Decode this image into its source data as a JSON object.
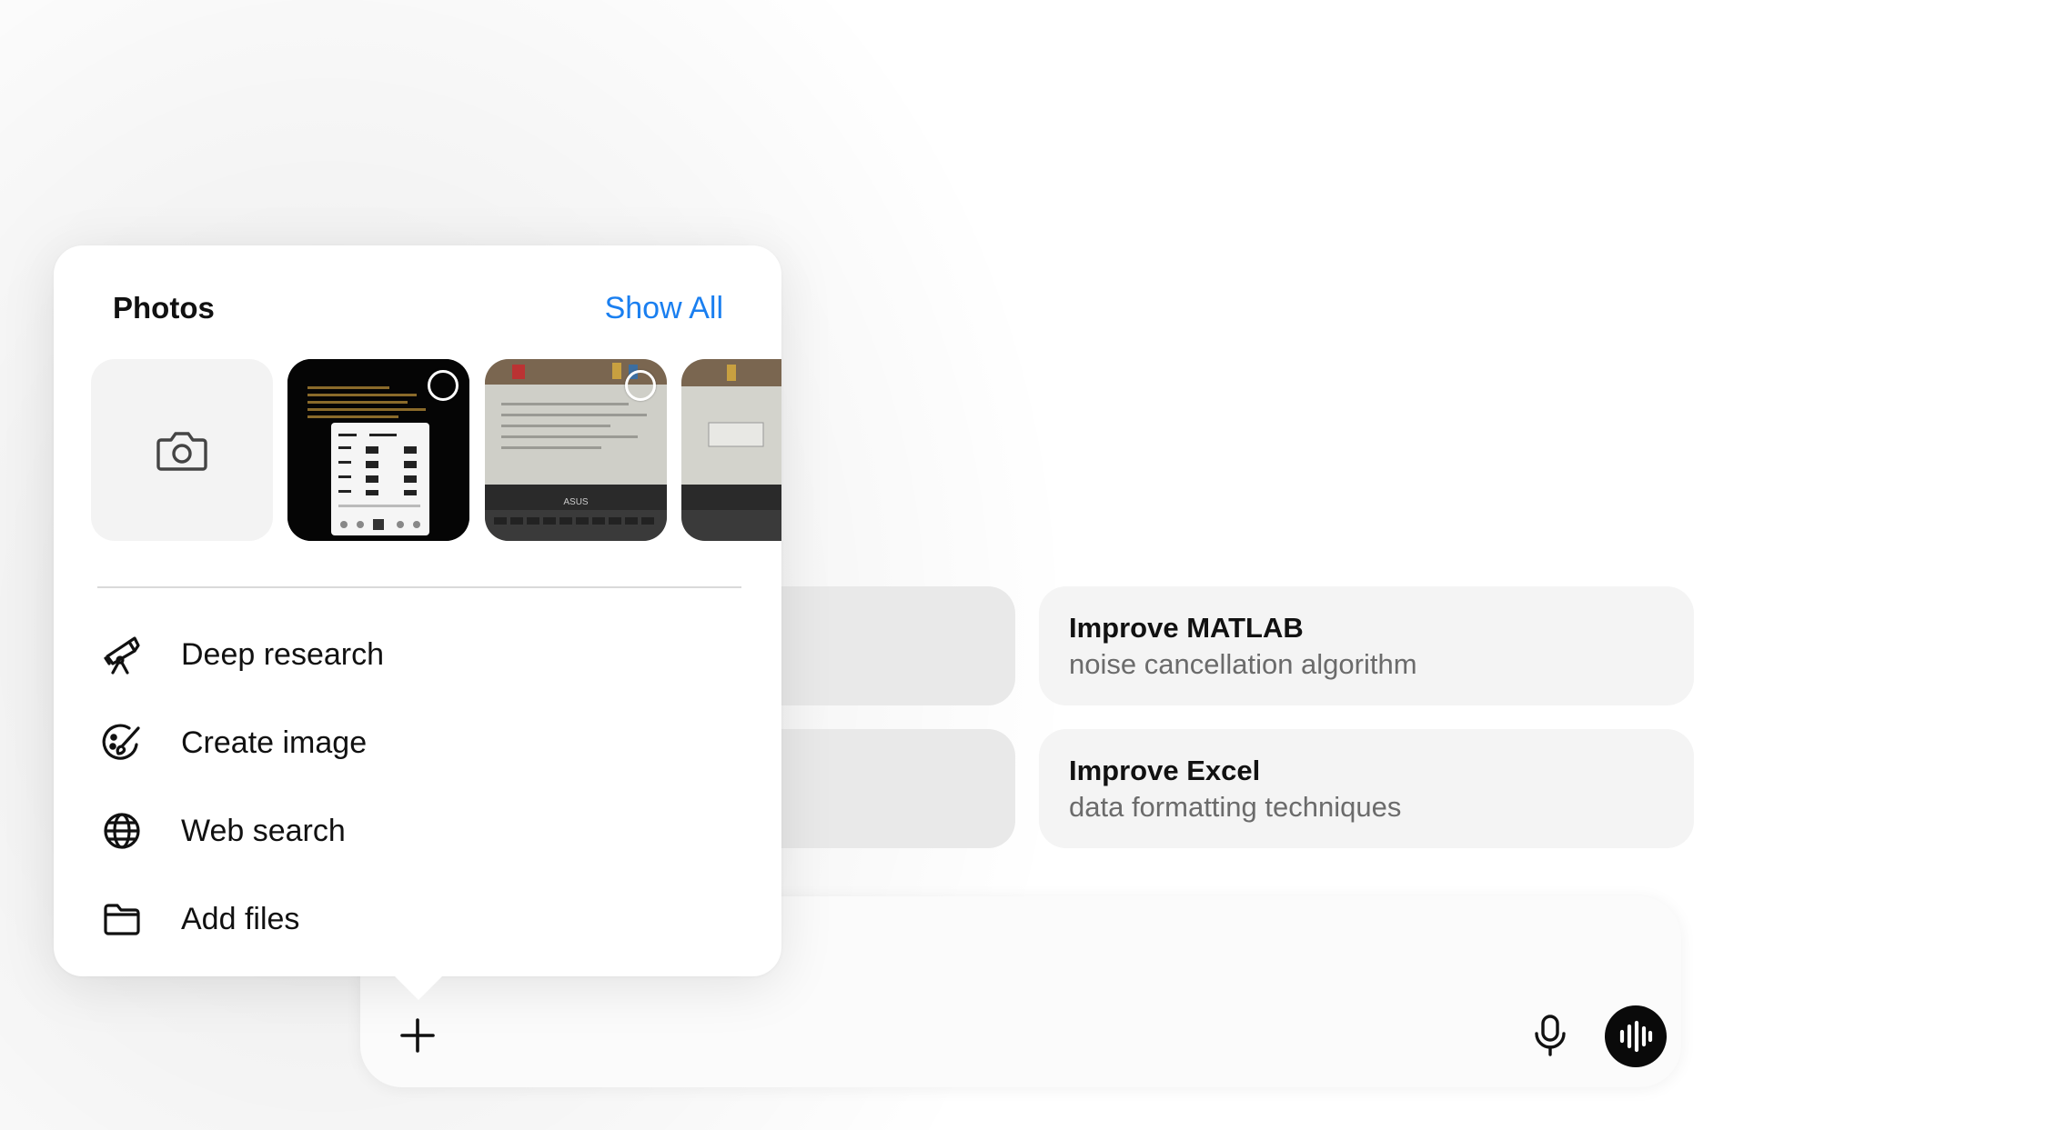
{
  "popover": {
    "title": "Photos",
    "show_all": "Show All",
    "menu": [
      {
        "label": "Deep research",
        "icon": "telescope-icon"
      },
      {
        "label": "Create image",
        "icon": "paint-palette-icon"
      },
      {
        "label": "Web search",
        "icon": "globe-icon"
      },
      {
        "label": "Add files",
        "icon": "folder-icon"
      }
    ]
  },
  "suggestions": [
    {
      "title": "Improve MATLAB",
      "subtitle": "noise cancellation algorithm"
    },
    {
      "title": "Improve Excel",
      "subtitle": "data formatting techniques"
    }
  ],
  "composer": {
    "plus_icon": "plus-icon",
    "mic_icon": "microphone-icon",
    "voice_icon": "voice-mode-icon"
  },
  "colors": {
    "accent": "#1a7ff0",
    "voice_button": "#0a0a0a",
    "card_bg": "#f4f4f4"
  }
}
